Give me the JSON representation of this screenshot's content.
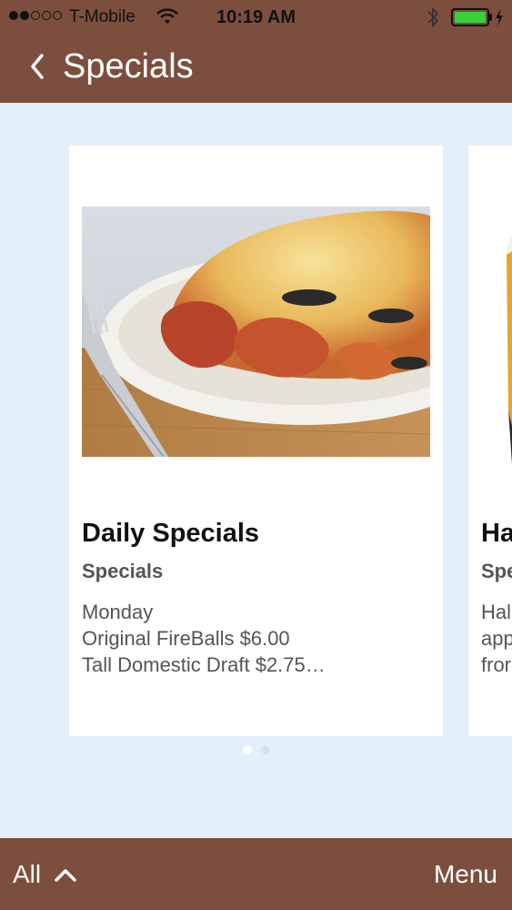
{
  "status_bar": {
    "carrier": "T-Mobile",
    "time": "10:19 AM",
    "signal_bars_filled": 2,
    "signal_bars_total": 5,
    "battery_level": 1.0,
    "battery_color": "#35d23a"
  },
  "header": {
    "title": "Specials",
    "back_icon": "chevron-left-icon",
    "background": "#7c4e3d"
  },
  "cards": [
    {
      "title": "Daily Specials",
      "subtitle": "Specials",
      "description": [
        "Monday",
        "Original FireBalls $6.00",
        "Tall Domestic Draft $2.75…"
      ],
      "image": "food-photo"
    },
    {
      "title": "Ha",
      "subtitle": "Spe",
      "description": [
        "Hal",
        "app",
        "fror"
      ],
      "image": "beer-photo"
    }
  ],
  "pager": {
    "count": 2,
    "active": 0
  },
  "bottom_bar": {
    "filter_label": "All",
    "filter_icon": "chevron-up-icon",
    "menu_label": "Menu"
  }
}
